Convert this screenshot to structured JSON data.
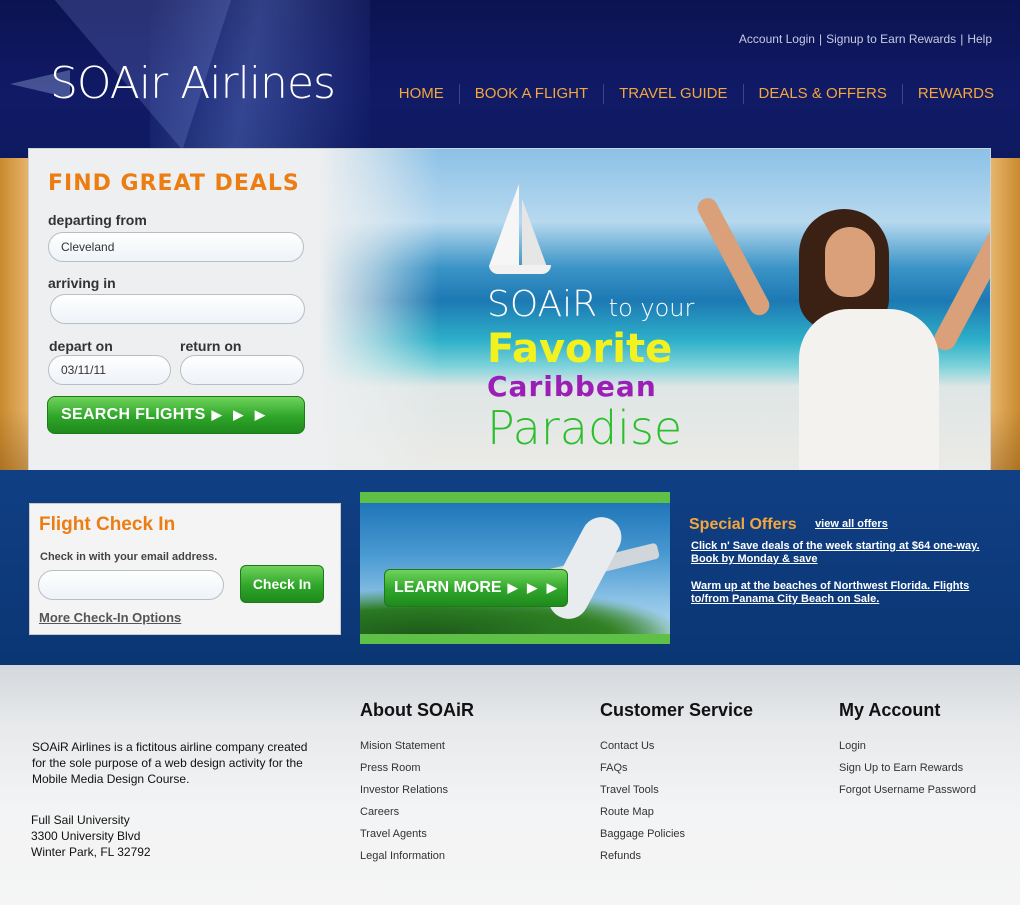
{
  "brand": {
    "logo_text": "SOAir Airlines"
  },
  "top_links": {
    "account_login": "Account Login",
    "signup": "Signup to Earn Rewards",
    "help": "Help",
    "separator": "|"
  },
  "nav": [
    "HOME",
    "BOOK A FLIGHT",
    "TRAVEL GUIDE",
    "DEALS & OFFERS",
    "REWARDS"
  ],
  "find_deals": {
    "title": "FIND GREAT DEALS",
    "departing_label": "departing from",
    "departing_value": "Cleveland",
    "arriving_label": "arriving in",
    "arriving_value": "",
    "depart_label": "depart on",
    "depart_value": "03/11/11",
    "return_label": "return on",
    "return_value": "",
    "search_button": "SEARCH FLIGHTS",
    "arrows": "▶ ▶ ▶"
  },
  "hero": {
    "line1_brand": "SOAiR",
    "line1_rest": "to your",
    "line2": "Favorite",
    "line3": "Caribbean",
    "line4": "Paradise"
  },
  "checkin": {
    "title": "Flight Check In",
    "instruction": "Check in with your email address.",
    "email_value": "",
    "button": "Check In",
    "more_link": "More Check-In Options"
  },
  "promo": {
    "button": "LEARN MORE",
    "arrows": "▶ ▶ ▶"
  },
  "offers": {
    "title": "Special Offers",
    "view_all": "view all offers",
    "deal1": "Click n' Save deals of the week starting at $64 one-way. Book by Monday & save",
    "deal2": "Warm up at the beaches of Northwest Florida.  Flights to/from Panama City Beach on Sale."
  },
  "footer": {
    "about_text": "SOAiR Airlines is a fictitous airline company created for the sole purpose of a web design activity for the Mobile Media Design Course.",
    "address_line1": "Full Sail University",
    "address_line2": "3300 University Blvd",
    "address_line3": "Winter Park, FL 32792",
    "about": {
      "heading": "About SOAiR",
      "links": [
        "Mision Statement",
        "Press Room",
        "Investor Relations",
        "Careers",
        "Travel Agents",
        "Legal Information"
      ]
    },
    "service": {
      "heading": "Customer Service",
      "links": [
        "Contact Us",
        "FAQs",
        "Travel Tools",
        "Route Map",
        "Baggage Policies",
        "Refunds"
      ]
    },
    "account": {
      "heading": "My Account",
      "links": [
        "Login",
        "Sign Up to Earn Rewards",
        "Forgot Username Password"
      ]
    }
  },
  "colors": {
    "navy": "#0c1352",
    "orange": "#ec7d12",
    "gold": "#f3a73c",
    "green": "#2fa52a",
    "blue_band": "#0c3a7c"
  }
}
